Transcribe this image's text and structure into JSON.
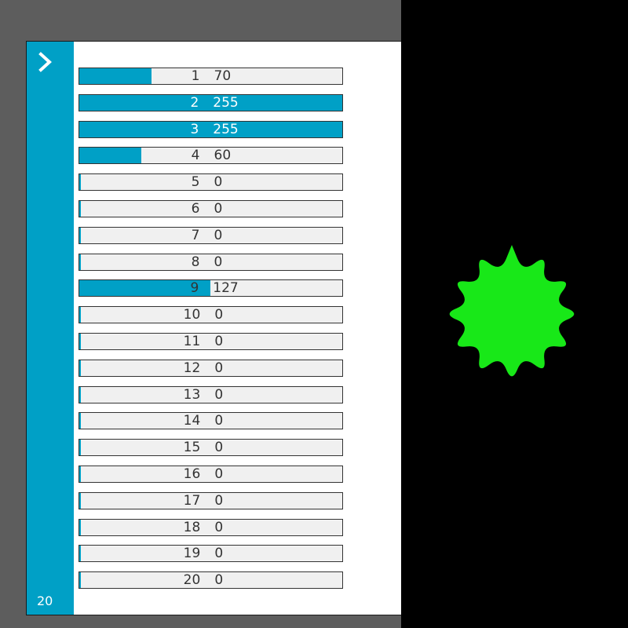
{
  "panel": {
    "count_label": "20",
    "chevron_icon": "chevron-right-icon",
    "accent_color": "#00a0c6",
    "track_color": "#f0f0f0",
    "max_value": 255
  },
  "bars": [
    {
      "index": "1",
      "value": "70",
      "level": 70
    },
    {
      "index": "2",
      "value": "255",
      "level": 255
    },
    {
      "index": "3",
      "value": "255",
      "level": 255
    },
    {
      "index": "4",
      "value": "60",
      "level": 60
    },
    {
      "index": "5",
      "value": "0",
      "level": 0
    },
    {
      "index": "6",
      "value": "0",
      "level": 0
    },
    {
      "index": "7",
      "value": "0",
      "level": 0
    },
    {
      "index": "8",
      "value": "0",
      "level": 0
    },
    {
      "index": "9",
      "value": "127",
      "level": 127
    },
    {
      "index": "10",
      "value": "0",
      "level": 0
    },
    {
      "index": "11",
      "value": "0",
      "level": 0
    },
    {
      "index": "12",
      "value": "0",
      "level": 0
    },
    {
      "index": "13",
      "value": "0",
      "level": 0
    },
    {
      "index": "14",
      "value": "0",
      "level": 0
    },
    {
      "index": "15",
      "value": "0",
      "level": 0
    },
    {
      "index": "16",
      "value": "0",
      "level": 0
    },
    {
      "index": "17",
      "value": "0",
      "level": 0
    },
    {
      "index": "18",
      "value": "0",
      "level": 0
    },
    {
      "index": "19",
      "value": "0",
      "level": 0
    },
    {
      "index": "20",
      "value": "0",
      "level": 0
    }
  ],
  "canvas": {
    "background_color": "#000000",
    "shape_icon": "spiky-sun-icon",
    "shape_color": "#18e818"
  }
}
